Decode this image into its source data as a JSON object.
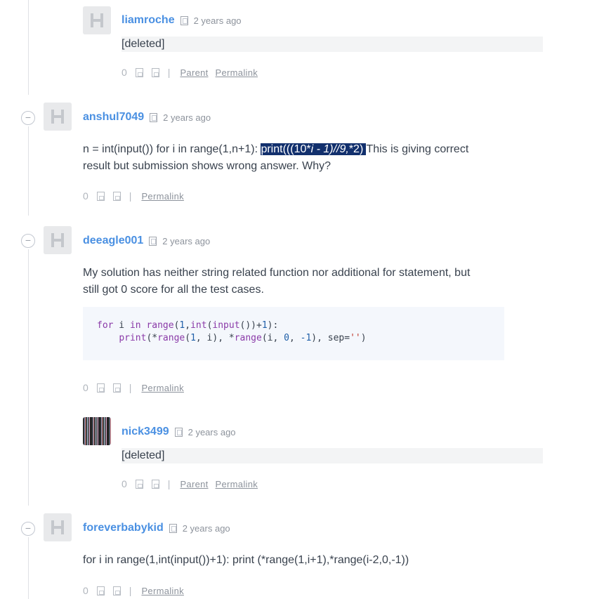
{
  "comments": [
    {
      "username": "liamroche",
      "timestamp": "2 years ago",
      "body": "[deleted]",
      "votes": "0",
      "links": [
        "Parent",
        "Permalink"
      ]
    },
    {
      "username": "anshul7049",
      "timestamp": "2 years ago",
      "body_pre": "n = int(input()) for i in range(1,n+1): ",
      "body_hl_1": "print(((10*",
      "body_hl_i": "i - 1)//9,",
      "body_hl_2": "*2) ",
      "body_post": "This is giving correct",
      "body_line2": "result but submission shows wrong answer. Why?",
      "votes": "0",
      "links": [
        "Permalink"
      ]
    },
    {
      "username": "deeagle001",
      "timestamp": "2 years ago",
      "body_line1": "My solution has neither string related function nor additional for statement, but",
      "body_line2": "still got 0 score for all the test cases.",
      "code": [
        "for i in range(1,int(input())+1):",
        "    print(*range(1, i), *range(i, 0, -1), sep='')"
      ],
      "votes": "0",
      "links": [
        "Permalink"
      ]
    },
    {
      "username": "nick3499",
      "timestamp": "2 years ago",
      "body": "[deleted]",
      "votes": "0",
      "links": [
        "Parent",
        "Permalink"
      ]
    },
    {
      "username": "foreverbabykid",
      "timestamp": "2 years ago",
      "body": "for i in range(1,int(input())+1): print (*range(1,i+1),*range(i-2,0,-1))",
      "votes": "0",
      "links": [
        "Permalink"
      ]
    }
  ],
  "icons": {
    "collapse": "−",
    "flag": "flag-icon",
    "upvote": "upvote-icon",
    "downvote": "downvote-icon"
  },
  "colors": {
    "username": "#4a90e2",
    "highlight_bg": "#12306d",
    "code_bg": "#f4f7fc"
  }
}
